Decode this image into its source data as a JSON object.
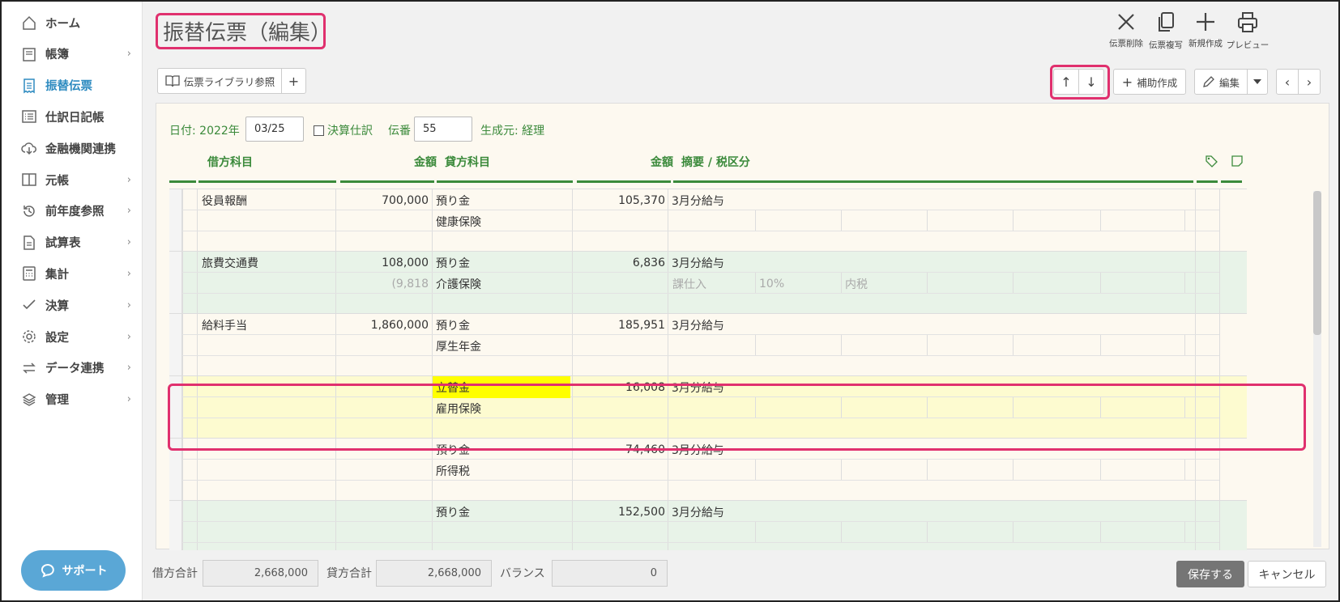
{
  "sidebar": {
    "items": [
      {
        "label": "ホーム",
        "icon": "home-icon",
        "chevron": false
      },
      {
        "label": "帳簿",
        "icon": "book-icon",
        "chevron": true
      },
      {
        "label": "振替伝票",
        "icon": "voucher-icon",
        "chevron": false,
        "active": true
      },
      {
        "label": "仕訳日記帳",
        "icon": "list-icon",
        "chevron": false
      },
      {
        "label": "金融機関連携",
        "icon": "cloud-download-icon",
        "chevron": false
      },
      {
        "label": "元帳",
        "icon": "ledger-icon",
        "chevron": true
      },
      {
        "label": "前年度参照",
        "icon": "history-icon",
        "chevron": true
      },
      {
        "label": "試算表",
        "icon": "document-icon",
        "chevron": true
      },
      {
        "label": "集計",
        "icon": "calculator-icon",
        "chevron": true
      },
      {
        "label": "決算",
        "icon": "check-icon",
        "chevron": true
      },
      {
        "label": "設定",
        "icon": "gear-icon",
        "chevron": true
      },
      {
        "label": "データ連携",
        "icon": "sync-icon",
        "chevron": true
      },
      {
        "label": "管理",
        "icon": "layers-icon",
        "chevron": true
      }
    ],
    "support_label": "サポート"
  },
  "header": {
    "title": "振替伝票（編集)",
    "title_display": "振替伝票（編集）",
    "actions": [
      {
        "label": "伝票削除",
        "icon": "close-icon"
      },
      {
        "label": "伝票複写",
        "icon": "copy-icon"
      },
      {
        "label": "新規作成",
        "icon": "plus-icon"
      },
      {
        "label": "プレビュー",
        "icon": "printer-icon"
      }
    ]
  },
  "toolbar": {
    "library_label": "伝票ライブラリ参照",
    "add_label": "+",
    "up_label": "↑",
    "down_label": "↓",
    "aux_create_label": "補助作成",
    "edit_label": "編集",
    "prev_label": "‹",
    "next_label": "›"
  },
  "form": {
    "date_label": "日付: 2022年",
    "date_value": "03/25",
    "settlement_label": "決算仕訳",
    "number_label": "伝番",
    "number_value": "55",
    "origin_label": "生成元: 経理"
  },
  "columns": {
    "debit_account": "借方科目",
    "debit_amount": "金額",
    "credit_account": "貸方科目",
    "credit_amount": "金額",
    "memo": "摘要 / 税区分"
  },
  "entries": [
    {
      "debit": "役員報酬",
      "debit_amount": "700,000",
      "credit": "預り金",
      "credit_sub": "健康保険",
      "credit_amount": "105,370",
      "memo": "3月分給与",
      "tax": [
        "",
        "",
        ""
      ],
      "tax_amount": "",
      "bg": "#fdf9f0"
    },
    {
      "debit": "旅費交通費",
      "debit_amount": "108,000",
      "credit": "預り金",
      "credit_sub": "介護保険",
      "credit_amount": "6,836",
      "memo": "3月分給与",
      "tax": [
        "課仕入",
        "10%",
        "内税"
      ],
      "tax_amount": "(9,818",
      "bg": "#e8f3e8"
    },
    {
      "debit": "給料手当",
      "debit_amount": "1,860,000",
      "credit": "預り金",
      "credit_sub": "厚生年金",
      "credit_amount": "185,951",
      "memo": "3月分給与",
      "tax": [
        "",
        "",
        ""
      ],
      "tax_amount": "",
      "bg": "#fdf9f0"
    },
    {
      "debit": "",
      "debit_amount": "",
      "credit": "立替金",
      "credit_sub": "雇用保険",
      "credit_amount": "16,008",
      "memo": "3月分給与",
      "tax": [
        "",
        "",
        ""
      ],
      "tax_amount": "",
      "bg": "#fdfbd0",
      "yellow": true
    },
    {
      "debit": "",
      "debit_amount": "",
      "credit": "預り金",
      "credit_sub": "所得税",
      "credit_amount": "74,460",
      "memo": "3月分給与",
      "tax": [
        "",
        "",
        ""
      ],
      "tax_amount": "",
      "bg": "#fdf9f0"
    },
    {
      "debit": "",
      "debit_amount": "",
      "credit": "預り金",
      "credit_sub": "",
      "credit_amount": "152,500",
      "memo": "3月分給与",
      "tax": [
        "",
        "",
        ""
      ],
      "tax_amount": "",
      "bg": "#e8f3e8"
    }
  ],
  "footer": {
    "debit_total_label": "借方合計",
    "debit_total": "2,668,000",
    "credit_total_label": "貸方合計",
    "credit_total": "2,668,000",
    "balance_label": "バランス",
    "balance": "0",
    "save_label": "保存する",
    "cancel_label": "キャンセル"
  },
  "colors": {
    "accent": "#2e8bc0",
    "green": "#3b8a3b",
    "highlight": "#e0306e",
    "yellow": "#ffff00"
  }
}
